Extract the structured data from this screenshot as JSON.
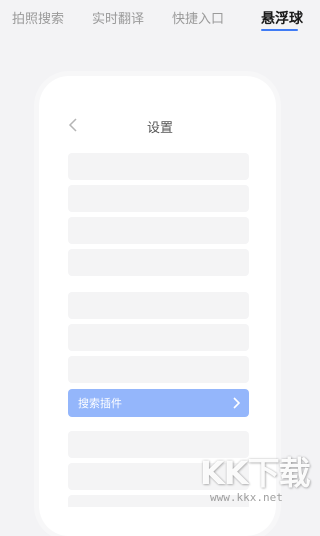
{
  "tabs": [
    {
      "label": "拍照搜索",
      "active": false
    },
    {
      "label": "实时翻译",
      "active": false
    },
    {
      "label": "快捷入口",
      "active": false
    },
    {
      "label": "悬浮球",
      "active": true
    }
  ],
  "accent_color": "#3f7bf5",
  "screen": {
    "title": "设置",
    "back_icon": "chevron-left-icon",
    "highlight_item": {
      "label": "搜索插件",
      "icon": "chevron-right-icon"
    }
  },
  "watermark": {
    "logo": "KK下载",
    "url": "www.kkx.net"
  }
}
